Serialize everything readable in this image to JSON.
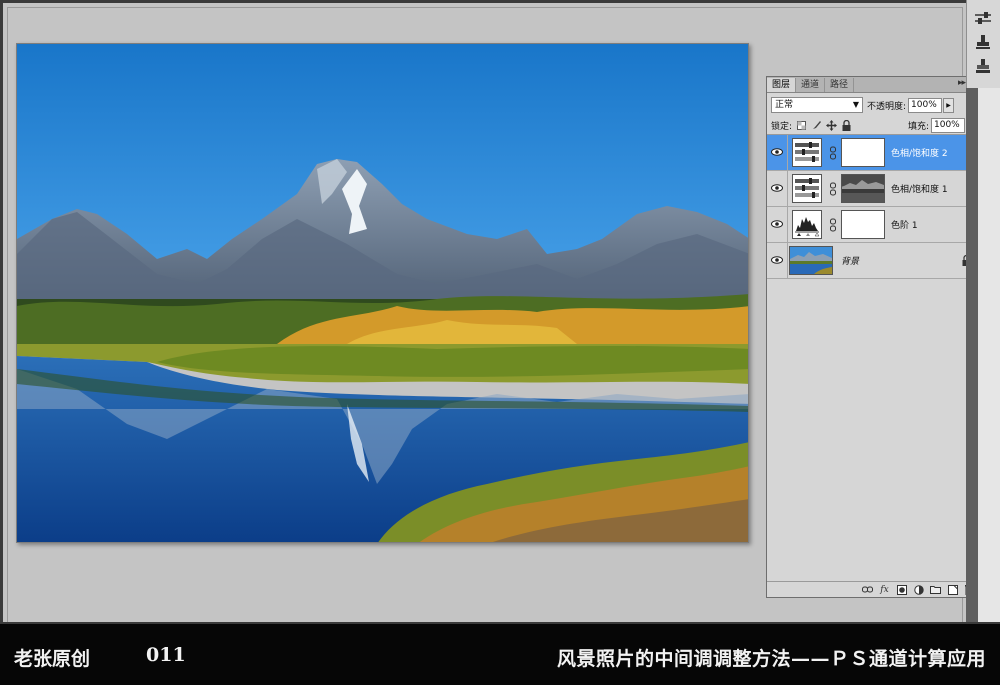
{
  "panel": {
    "tabs": [
      {
        "label": "图层",
        "active": true
      },
      {
        "label": "通道",
        "active": false
      },
      {
        "label": "路径",
        "active": false
      }
    ],
    "blend_mode": "正常",
    "opacity_label": "不透明度:",
    "opacity_value": "100%",
    "lock_label": "锁定:",
    "fill_label": "填充:",
    "fill_value": "100%"
  },
  "layers": [
    {
      "name": "色相/饱和度 2",
      "type": "hue-saturation",
      "selected": true,
      "mask": "white"
    },
    {
      "name": "色相/饱和度 1",
      "type": "hue-saturation",
      "selected": false,
      "mask": "photo"
    },
    {
      "name": "色阶 1",
      "type": "levels",
      "selected": false,
      "mask": "white"
    },
    {
      "name": "背景",
      "type": "background",
      "selected": false,
      "locked": true
    }
  ],
  "caption": {
    "author": "老张原创",
    "number": "011",
    "title": "风景照片的中间调调整方法——ＰＳ通道计算应用"
  },
  "colors": {
    "selected_layer": "#4b94e8",
    "panel_bg": "#d6d6d6",
    "canvas_bg": "#c4c4c4",
    "caption_bg": "#060606"
  }
}
